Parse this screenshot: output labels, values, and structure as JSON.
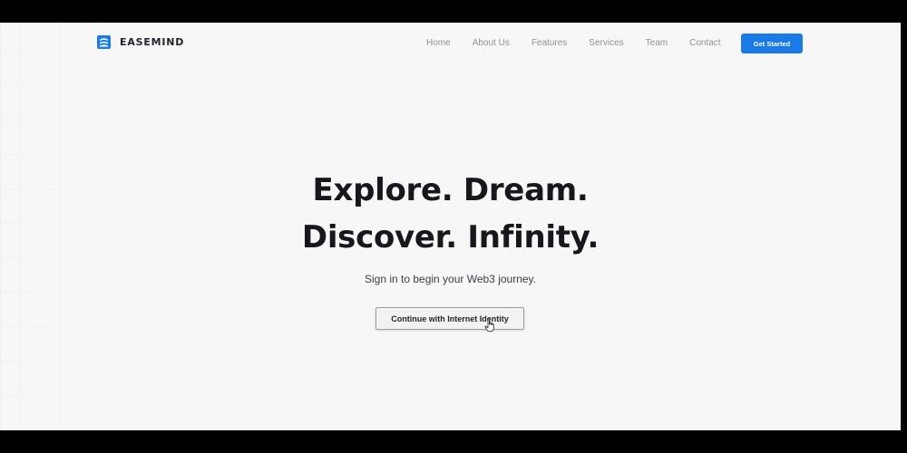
{
  "brand": {
    "name": "EASEMIND",
    "icon": "logo-icon",
    "accent": "#1a7be6"
  },
  "nav": {
    "links": [
      "Home",
      "About Us",
      "Features",
      "Services",
      "Team",
      "Contact"
    ],
    "cta": "Get Started"
  },
  "hero": {
    "headline_line1": "Explore. Dream.",
    "headline_line2": "Discover. Infinity.",
    "subtitle": "Sign in to begin your Web3 journey.",
    "signin_button": "Continue with Internet Identity"
  },
  "cursor": {
    "icon": "hand-pointer-icon"
  }
}
